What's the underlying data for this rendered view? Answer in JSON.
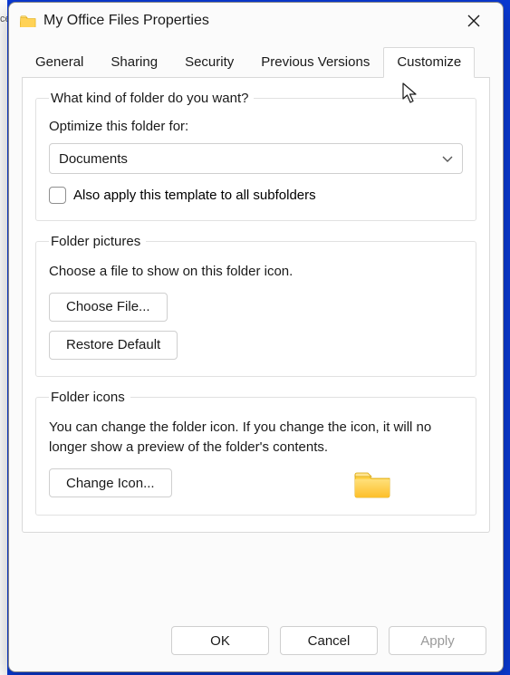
{
  "window": {
    "title": "My Office Files Properties"
  },
  "tabs": [
    {
      "label": "General"
    },
    {
      "label": "Sharing"
    },
    {
      "label": "Security"
    },
    {
      "label": "Previous Versions"
    },
    {
      "label": "Customize",
      "active": true
    }
  ],
  "customize": {
    "kind": {
      "legend": "What kind of folder do you want?",
      "optimize_label": "Optimize this folder for:",
      "selected": "Documents",
      "subfolders_label": "Also apply this template to all subfolders"
    },
    "pictures": {
      "legend": "Folder pictures",
      "desc": "Choose a file to show on this folder icon.",
      "choose_label": "Choose File...",
      "restore_label": "Restore Default"
    },
    "icons": {
      "legend": "Folder icons",
      "desc": "You can change the folder icon. If you change the icon, it will no longer show a preview of the folder's contents.",
      "change_label": "Change Icon..."
    }
  },
  "footer": {
    "ok": "OK",
    "cancel": "Cancel",
    "apply": "Apply"
  }
}
